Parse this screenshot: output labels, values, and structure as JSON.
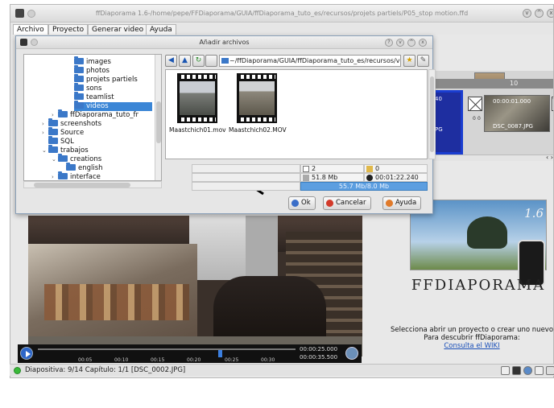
{
  "app": {
    "title": "ffDiaporama 1.6-/home/pepe/FFDiaporama/GUIA/ffDiaporama_tuto_es/recursos/projets partiels/P05_stop motion.ffd",
    "menu": [
      "Archivo",
      "Proyecto",
      "Generar video",
      "Ayuda"
    ]
  },
  "dialog": {
    "title": "Añadir archivos",
    "path": "~/ffDiaporama/GUIA/ffDiaporama_tuto_es/recursos/videos",
    "tree": [
      {
        "label": "images"
      },
      {
        "label": "photos"
      },
      {
        "label": "projets partiels"
      },
      {
        "label": "sons"
      },
      {
        "label": "teamlist"
      },
      {
        "label": "videos",
        "selected": true
      },
      {
        "label": "ffDiaporama_tuto_fr"
      },
      {
        "label": "screenshots"
      },
      {
        "label": "Source"
      },
      {
        "label": "SQL"
      },
      {
        "label": "trabajos"
      },
      {
        "label": "creations"
      },
      {
        "label": "english"
      },
      {
        "label": "interface"
      }
    ],
    "files": [
      {
        "name": "Maastchich01.mov"
      },
      {
        "name": "Maastchich02.MOV"
      }
    ],
    "info": {
      "count": "2",
      "count2": "0",
      "size": "51.8 Mb",
      "duration": "00:01:22.240",
      "memory": "55.7 Mb/8.0 Mb"
    },
    "buttons": {
      "ok": "Ok",
      "cancel": "Cancelar",
      "help": "Ayuda"
    }
  },
  "timeline": {
    "header": "10",
    "slide_numbers": [
      "0",
      "0"
    ],
    "thumb_time": "00:00:01.000",
    "thumb_name": "DSC_0087.JPG",
    "left_thumb_label": "PG"
  },
  "preview": {
    "ticks": [
      "00:05",
      "00:10",
      "00:15",
      "00:20",
      "00:25",
      "00:30"
    ],
    "time_current": "00:00:25.000",
    "time_total": "00:00:35.500",
    "position_fraction": 0.7
  },
  "splash": {
    "version": "1.6",
    "logo": "FFDIAPORAMA",
    "welcome_line1": "Selecciona abrir un proyecto o crear uno nuevo",
    "welcome_line2": "Para descubrir ffDiaporama:",
    "wiki_link": "Consulta el WIKI"
  },
  "status": {
    "text": "Diapositiva: 9/14   Capítulo: 1/1 [DSC_0002.JPG]"
  },
  "colors": {
    "accent": "#3b86d6",
    "selection": "#3b86d6",
    "status_ok": "#3aba3a",
    "timeline_selected": "#1a3dd0"
  }
}
